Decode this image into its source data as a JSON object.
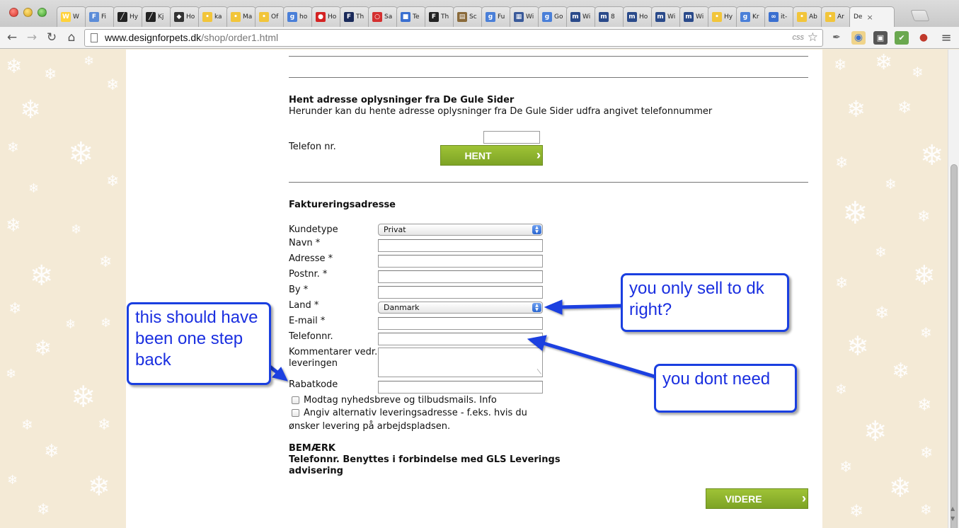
{
  "browser": {
    "tabs": [
      {
        "icon": "W",
        "color": "#ffd23b",
        "title": "W"
      },
      {
        "icon": "F",
        "color": "#5b8cd8",
        "title": "Fi"
      },
      {
        "icon": "╱",
        "color": "#222222",
        "title": "Hy"
      },
      {
        "icon": "╱",
        "color": "#222222",
        "title": "Kj"
      },
      {
        "icon": "◆",
        "color": "#333333",
        "title": "Ho"
      },
      {
        "icon": "•",
        "color": "#f2c53a",
        "title": "ka"
      },
      {
        "icon": "•",
        "color": "#f2c53a",
        "title": "Ma"
      },
      {
        "icon": "•",
        "color": "#f2c53a",
        "title": "Of"
      },
      {
        "icon": "g",
        "color": "#4a7fd8",
        "title": "ho"
      },
      {
        "icon": "●",
        "color": "#d42222",
        "title": "Ho"
      },
      {
        "icon": "F",
        "color": "#1a2a5a",
        "title": "Th"
      },
      {
        "icon": "○",
        "color": "#d43030",
        "title": "Sa"
      },
      {
        "icon": "■",
        "color": "#3a6fd0",
        "title": "Te"
      },
      {
        "icon": "F",
        "color": "#222222",
        "title": "Th"
      },
      {
        "icon": "▤",
        "color": "#8a6a3a",
        "title": "Sc"
      },
      {
        "icon": "g",
        "color": "#4a7fd8",
        "title": "Fu"
      },
      {
        "icon": "▦",
        "color": "#3a5a9a",
        "title": "Wi"
      },
      {
        "icon": "g",
        "color": "#4a7fd8",
        "title": "Go"
      },
      {
        "icon": "m",
        "color": "#2a4a8a",
        "title": "Wi"
      },
      {
        "icon": "m",
        "color": "#2a4a8a",
        "title": "8"
      },
      {
        "icon": "m",
        "color": "#2a4a8a",
        "title": "Ho"
      },
      {
        "icon": "m",
        "color": "#2a4a8a",
        "title": "Wi"
      },
      {
        "icon": "m",
        "color": "#2a4a8a",
        "title": "Wi"
      },
      {
        "icon": "•",
        "color": "#f2c53a",
        "title": "Hy"
      },
      {
        "icon": "g",
        "color": "#4a7fd8",
        "title": "Kr"
      },
      {
        "icon": "∞",
        "color": "#3a6fd0",
        "title": "it-"
      },
      {
        "icon": "•",
        "color": "#f2c53a",
        "title": "Ab"
      },
      {
        "icon": "•",
        "color": "#f2c53a",
        "title": "Ar"
      }
    ],
    "active_tab": {
      "title": "De",
      "close": "×"
    },
    "url_host": "www.designforpets.dk",
    "url_path": "/shop/order1.html",
    "omni_badge": "css"
  },
  "lookup": {
    "heading": "Hent adresse oplysninger fra De Gule Sider",
    "description": "Herunder kan du hente adresse oplysninger fra De Gule Sider udfra angivet telefonnummer",
    "phone_label": "Telefon nr.",
    "button": "HENT"
  },
  "billing": {
    "heading": "Faktureringsadresse",
    "fields": {
      "kundetype": "Kundetype",
      "navn": "Navn *",
      "adresse": "Adresse *",
      "postnr": "Postnr. *",
      "by": "By *",
      "land": "Land *",
      "email": "E-mail *",
      "telefonnr": "Telefonnr.",
      "kommentar_1": "Kommentarer vedr.",
      "kommentar_2": "leveringen",
      "rabatkode": "Rabatkode"
    },
    "kundetype_value": "Privat",
    "land_value": "Danmark",
    "newsletter": "Modtag nyhedsbreve og tilbudsmails. Info",
    "alt_address_1": "Angiv alternativ leveringsadresse - f.eks. hvis du",
    "alt_address_2": "ønsker levering på arbejdspladsen."
  },
  "note": {
    "title": "BEMÆRK",
    "line1": "Telefonnr. Benyttes i forbindelse med GLS Leverings",
    "line2": "advisering"
  },
  "next_button": "VIDERE",
  "annotations": {
    "step_back": [
      "this should have",
      "been one step",
      "back"
    ],
    "dk_only": [
      "you only sell to dk",
      "right?"
    ],
    "not_needed": [
      "you dont need"
    ]
  },
  "colors": {
    "accent_green": "#8db22c",
    "annotation_blue": "#1a3fe0",
    "page_background": "#f4ead6"
  }
}
